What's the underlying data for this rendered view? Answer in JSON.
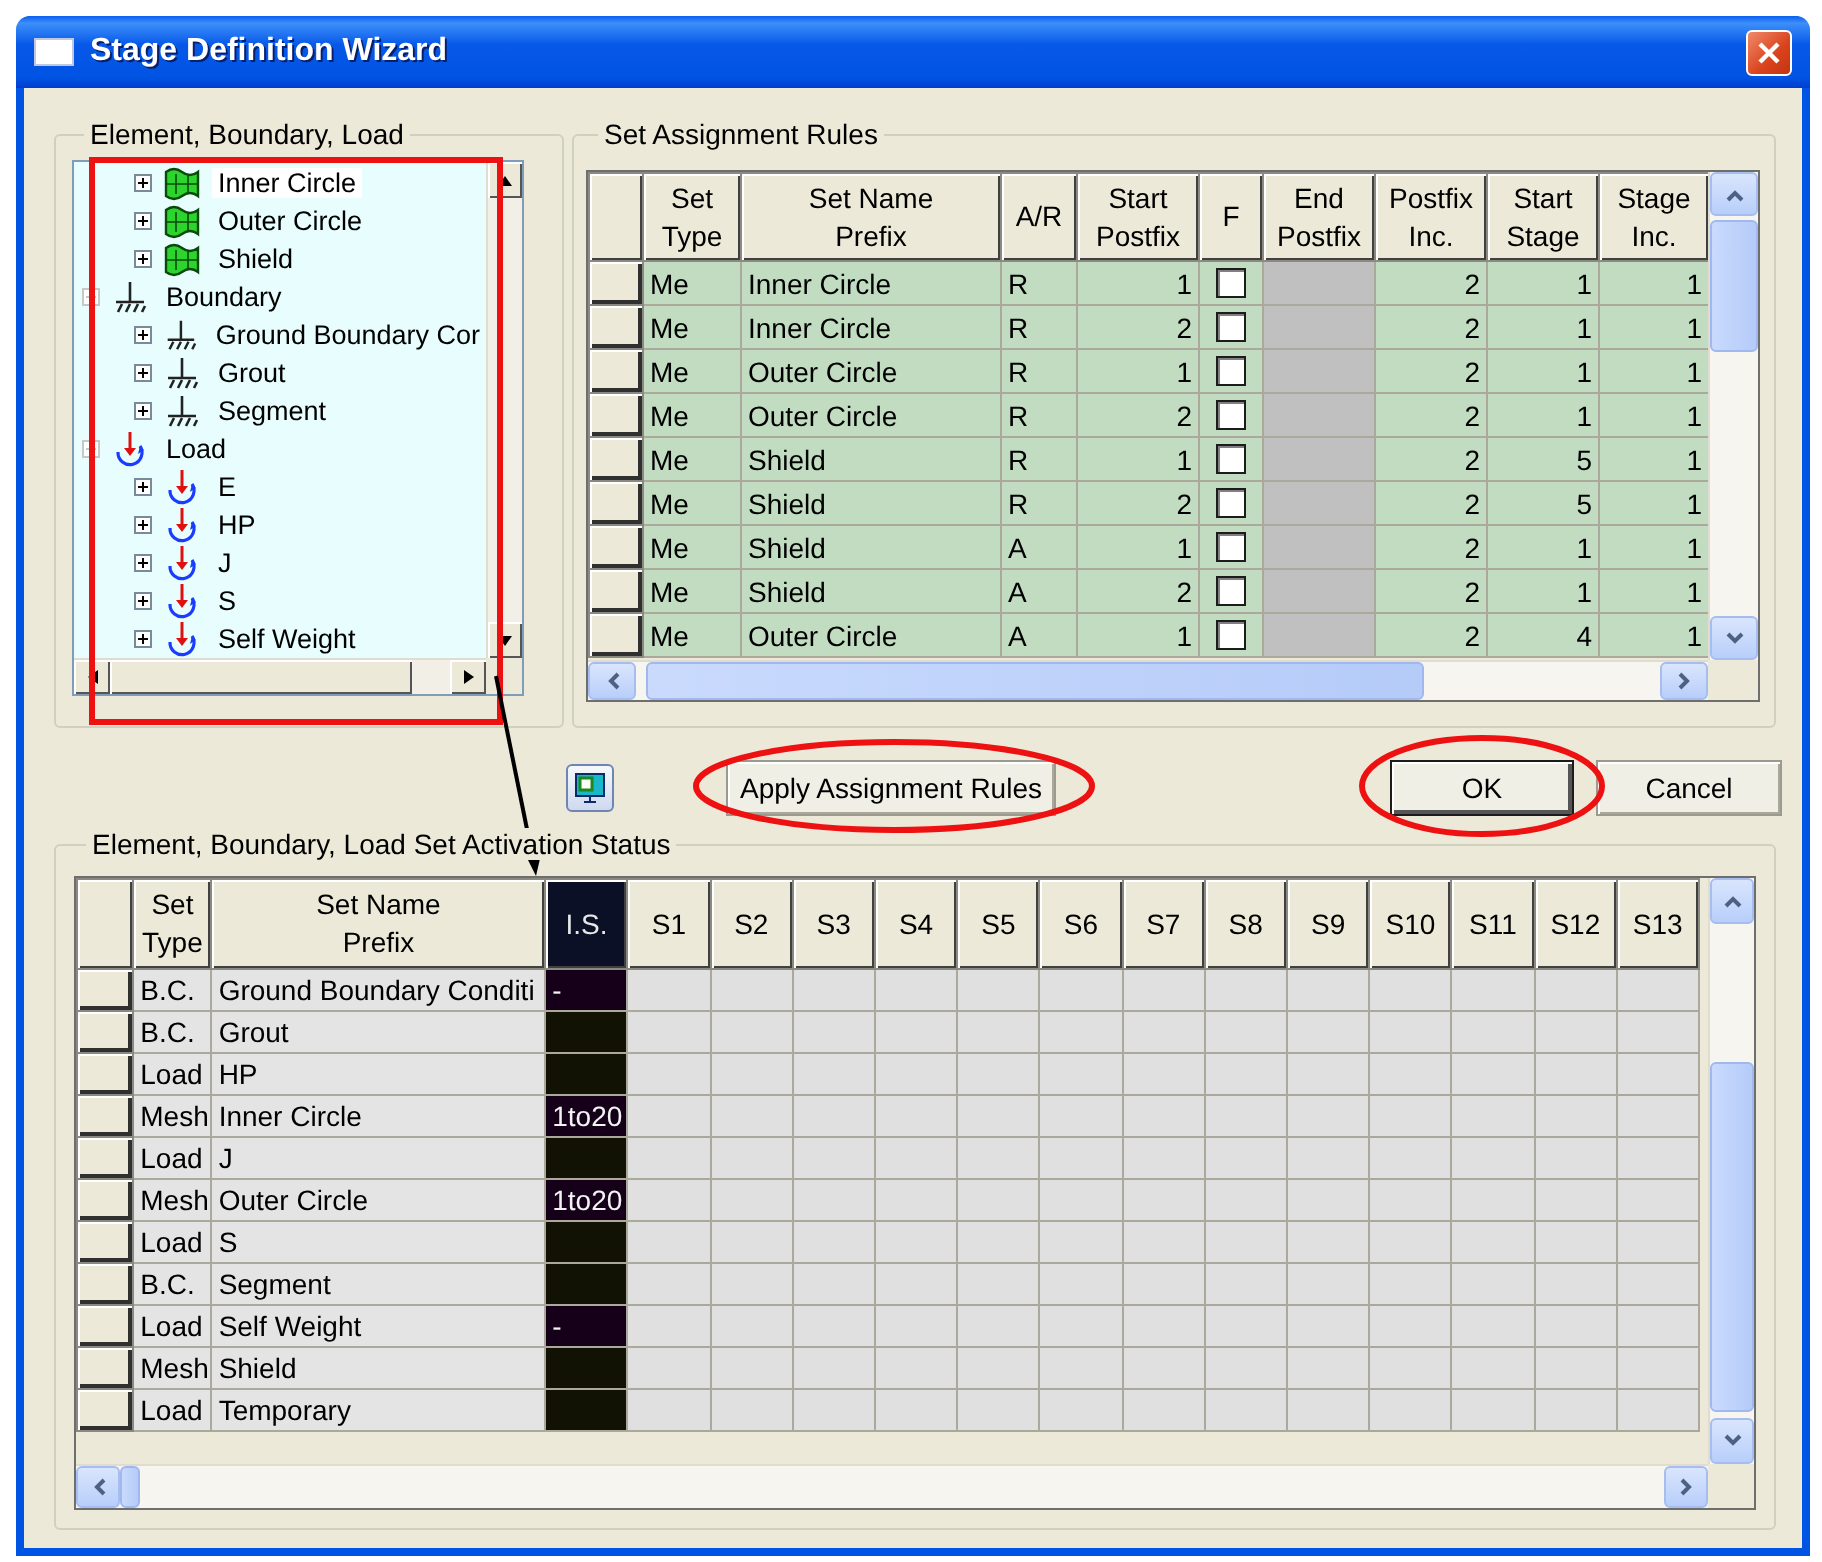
{
  "window": {
    "title": "Stage Definition Wizard"
  },
  "tree_panel": {
    "title": "Element, Boundary, Load",
    "items": [
      {
        "children": [
          {
            "label": "Inner Circle",
            "kind": "mesh",
            "expanded": false,
            "selected": true
          },
          {
            "label": "Outer Circle",
            "kind": "mesh",
            "expanded": false,
            "selected": false
          },
          {
            "label": "Shield",
            "kind": "mesh",
            "expanded": false,
            "selected": false
          }
        ]
      },
      {
        "label": "Boundary",
        "kind": "boundary",
        "expanded": true,
        "selected": false,
        "children": [
          {
            "label": "Ground Boundary Cor",
            "kind": "boundary",
            "expanded": false,
            "selected": false
          },
          {
            "label": "Grout",
            "kind": "boundary",
            "expanded": false,
            "selected": false
          },
          {
            "label": "Segment",
            "kind": "boundary",
            "expanded": false,
            "selected": false
          }
        ]
      },
      {
        "label": "Load",
        "kind": "load",
        "expanded": true,
        "selected": false,
        "children": [
          {
            "label": "E",
            "kind": "load",
            "expanded": false,
            "selected": false
          },
          {
            "label": "HP",
            "kind": "load",
            "expanded": false,
            "selected": false
          },
          {
            "label": "J",
            "kind": "load",
            "expanded": false,
            "selected": false
          },
          {
            "label": "S",
            "kind": "load",
            "expanded": false,
            "selected": false
          },
          {
            "label": "Self Weight",
            "kind": "load",
            "expanded": false,
            "selected": false
          }
        ]
      }
    ]
  },
  "rules_panel": {
    "title": "Set Assignment Rules",
    "columns": [
      {
        "label": "Set\nType",
        "disabled": false
      },
      {
        "label": "Set Name\nPrefix",
        "disabled": false
      },
      {
        "label": "A/R",
        "disabled": false
      },
      {
        "label": "Start\nPostfix",
        "disabled": false
      },
      {
        "label": "F",
        "disabled": false
      },
      {
        "label": "End\nPostfix",
        "disabled": true
      },
      {
        "label": "Postfix\nInc.",
        "disabled": false
      },
      {
        "label": "Start\nStage",
        "disabled": false
      },
      {
        "label": "Stage\nInc.",
        "disabled": false
      }
    ],
    "rows": [
      {
        "set_type": "Me",
        "prefix": "Inner Circle",
        "ar": "R",
        "start_postfix": "1",
        "f": false,
        "postfix_inc": "2",
        "start_stage": "1",
        "stage_inc": "1"
      },
      {
        "set_type": "Me",
        "prefix": "Inner Circle",
        "ar": "R",
        "start_postfix": "2",
        "f": false,
        "postfix_inc": "2",
        "start_stage": "1",
        "stage_inc": "1"
      },
      {
        "set_type": "Me",
        "prefix": "Outer Circle",
        "ar": "R",
        "start_postfix": "1",
        "f": false,
        "postfix_inc": "2",
        "start_stage": "1",
        "stage_inc": "1"
      },
      {
        "set_type": "Me",
        "prefix": "Outer Circle",
        "ar": "R",
        "start_postfix": "2",
        "f": false,
        "postfix_inc": "2",
        "start_stage": "1",
        "stage_inc": "1"
      },
      {
        "set_type": "Me",
        "prefix": "Shield",
        "ar": "R",
        "start_postfix": "1",
        "f": false,
        "postfix_inc": "2",
        "start_stage": "5",
        "stage_inc": "1"
      },
      {
        "set_type": "Me",
        "prefix": "Shield",
        "ar": "R",
        "start_postfix": "2",
        "f": false,
        "postfix_inc": "2",
        "start_stage": "5",
        "stage_inc": "1"
      },
      {
        "set_type": "Me",
        "prefix": "Shield",
        "ar": "A",
        "start_postfix": "1",
        "f": false,
        "postfix_inc": "2",
        "start_stage": "1",
        "stage_inc": "1"
      },
      {
        "set_type": "Me",
        "prefix": "Shield",
        "ar": "A",
        "start_postfix": "2",
        "f": false,
        "postfix_inc": "2",
        "start_stage": "1",
        "stage_inc": "1"
      },
      {
        "set_type": "Me",
        "prefix": "Outer Circle",
        "ar": "A",
        "start_postfix": "1",
        "f": false,
        "postfix_inc": "2",
        "start_stage": "4",
        "stage_inc": "1"
      }
    ]
  },
  "apply_button": "Apply Assignment Rules",
  "dialog_buttons": [
    {
      "label": "OK",
      "focused": true
    },
    {
      "label": "Cancel",
      "focused": false
    }
  ],
  "status_panel": {
    "title": "Element, Boundary, Load Set Activation Status",
    "columns": [
      {
        "label": "Set\nType",
        "selected": false
      },
      {
        "label": "Set Name\nPrefix",
        "selected": false
      },
      {
        "label": "I.S.",
        "selected": true
      },
      {
        "label": "S1",
        "selected": false
      },
      {
        "label": "S2",
        "selected": false
      },
      {
        "label": "S3",
        "selected": false
      },
      {
        "label": "S4",
        "selected": false
      },
      {
        "label": "S5",
        "selected": false
      },
      {
        "label": "S6",
        "selected": false
      },
      {
        "label": "S7",
        "selected": false
      },
      {
        "label": "S8",
        "selected": false
      },
      {
        "label": "S9",
        "selected": false
      },
      {
        "label": "S10",
        "selected": false
      },
      {
        "label": "S11",
        "selected": false
      },
      {
        "label": "S12",
        "selected": false
      },
      {
        "label": "S13",
        "selected": false
      }
    ],
    "rows": [
      {
        "set_type": "B.C.",
        "prefix": "Ground Boundary Conditi",
        "initial": "-"
      },
      {
        "set_type": "B.C.",
        "prefix": "Grout"
      },
      {
        "set_type": "Load",
        "prefix": "HP"
      },
      {
        "set_type": "Mesh",
        "prefix": "Inner Circle",
        "initial": "1to20"
      },
      {
        "set_type": "Load",
        "prefix": "J"
      },
      {
        "set_type": "Mesh",
        "prefix": "Outer Circle",
        "initial": "1to20"
      },
      {
        "set_type": "Load",
        "prefix": "S"
      },
      {
        "set_type": "B.C.",
        "prefix": "Segment"
      },
      {
        "set_type": "Load",
        "prefix": "Self Weight",
        "initial": "-"
      },
      {
        "set_type": "Mesh",
        "prefix": "Shield"
      },
      {
        "set_type": "Load",
        "prefix": "Temporary"
      }
    ]
  }
}
